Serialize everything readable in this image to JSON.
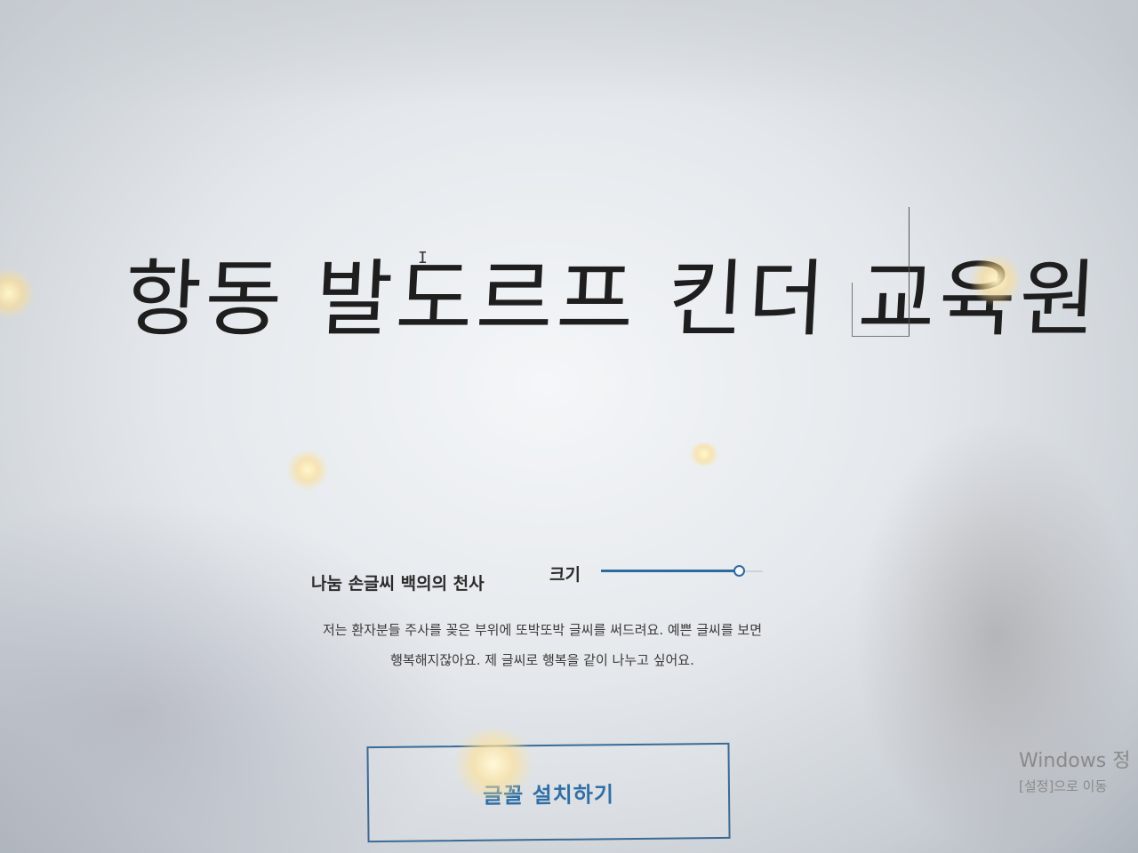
{
  "preview": {
    "sample_text": "항동 발도르프 킨더 교육원"
  },
  "font": {
    "name": "나눔 손글씨 백의의 천사",
    "size_label": "크기",
    "size_slider_value": 0.85
  },
  "description": {
    "line1": "저는 환자분들 주사를 꽂은 부위에 또박또박 글씨를 써드려요. 예쁜 글씨를 보면",
    "line2": "행복해지잖아요. 제 글씨로 행복을 같이 나누고 싶어요."
  },
  "install_button": {
    "label": "글꼴 설치하기"
  },
  "watermark": {
    "title": "Windows 정",
    "subtitle": "[설정]으로 이동"
  },
  "colors": {
    "accent": "#2d6aa0",
    "button_text": "#2f6fa6",
    "text": "#2b2b2b"
  }
}
